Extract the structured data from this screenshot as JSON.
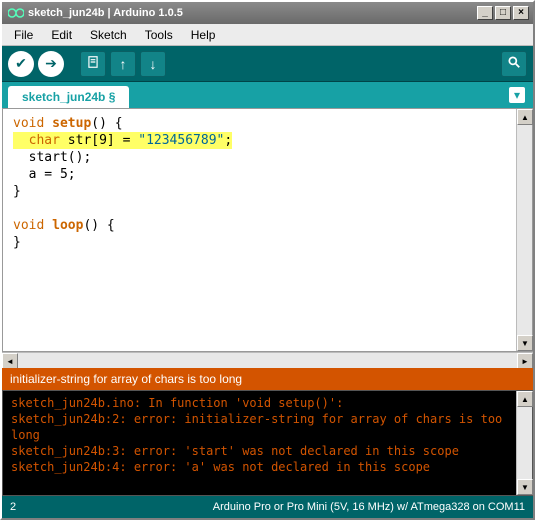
{
  "window": {
    "title": "sketch_jun24b | Arduino 1.0.5"
  },
  "menu": {
    "file": "File",
    "edit": "Edit",
    "sketch": "Sketch",
    "tools": "Tools",
    "help": "Help"
  },
  "tab": {
    "label": "sketch_jun24b §"
  },
  "code": {
    "l1a": "void",
    "l1b": "setup",
    "l1c": "() {",
    "l2a": "char",
    "l2b": " str[9] = ",
    "l2c": "\"123456789\"",
    "l2d": ";",
    "l3": "  start();",
    "l4": "  a = 5;",
    "l5": "}",
    "l6": "",
    "l7a": "void",
    "l7b": "loop",
    "l7c": "() {",
    "l8": "}"
  },
  "error": {
    "summary": "initializer-string for array of chars is too long"
  },
  "console": {
    "l1": "sketch_jun24b.ino: In function 'void setup()':",
    "l2": "sketch_jun24b:2: error: initializer-string for array of chars is too long",
    "l3": "sketch_jun24b:3: error: 'start' was not declared in this scope",
    "l4": "sketch_jun24b:4: error: 'a' was not declared in this scope"
  },
  "status": {
    "line": "2",
    "board": "Arduino Pro or Pro Mini (5V, 16 MHz) w/ ATmega328 on COM11"
  }
}
